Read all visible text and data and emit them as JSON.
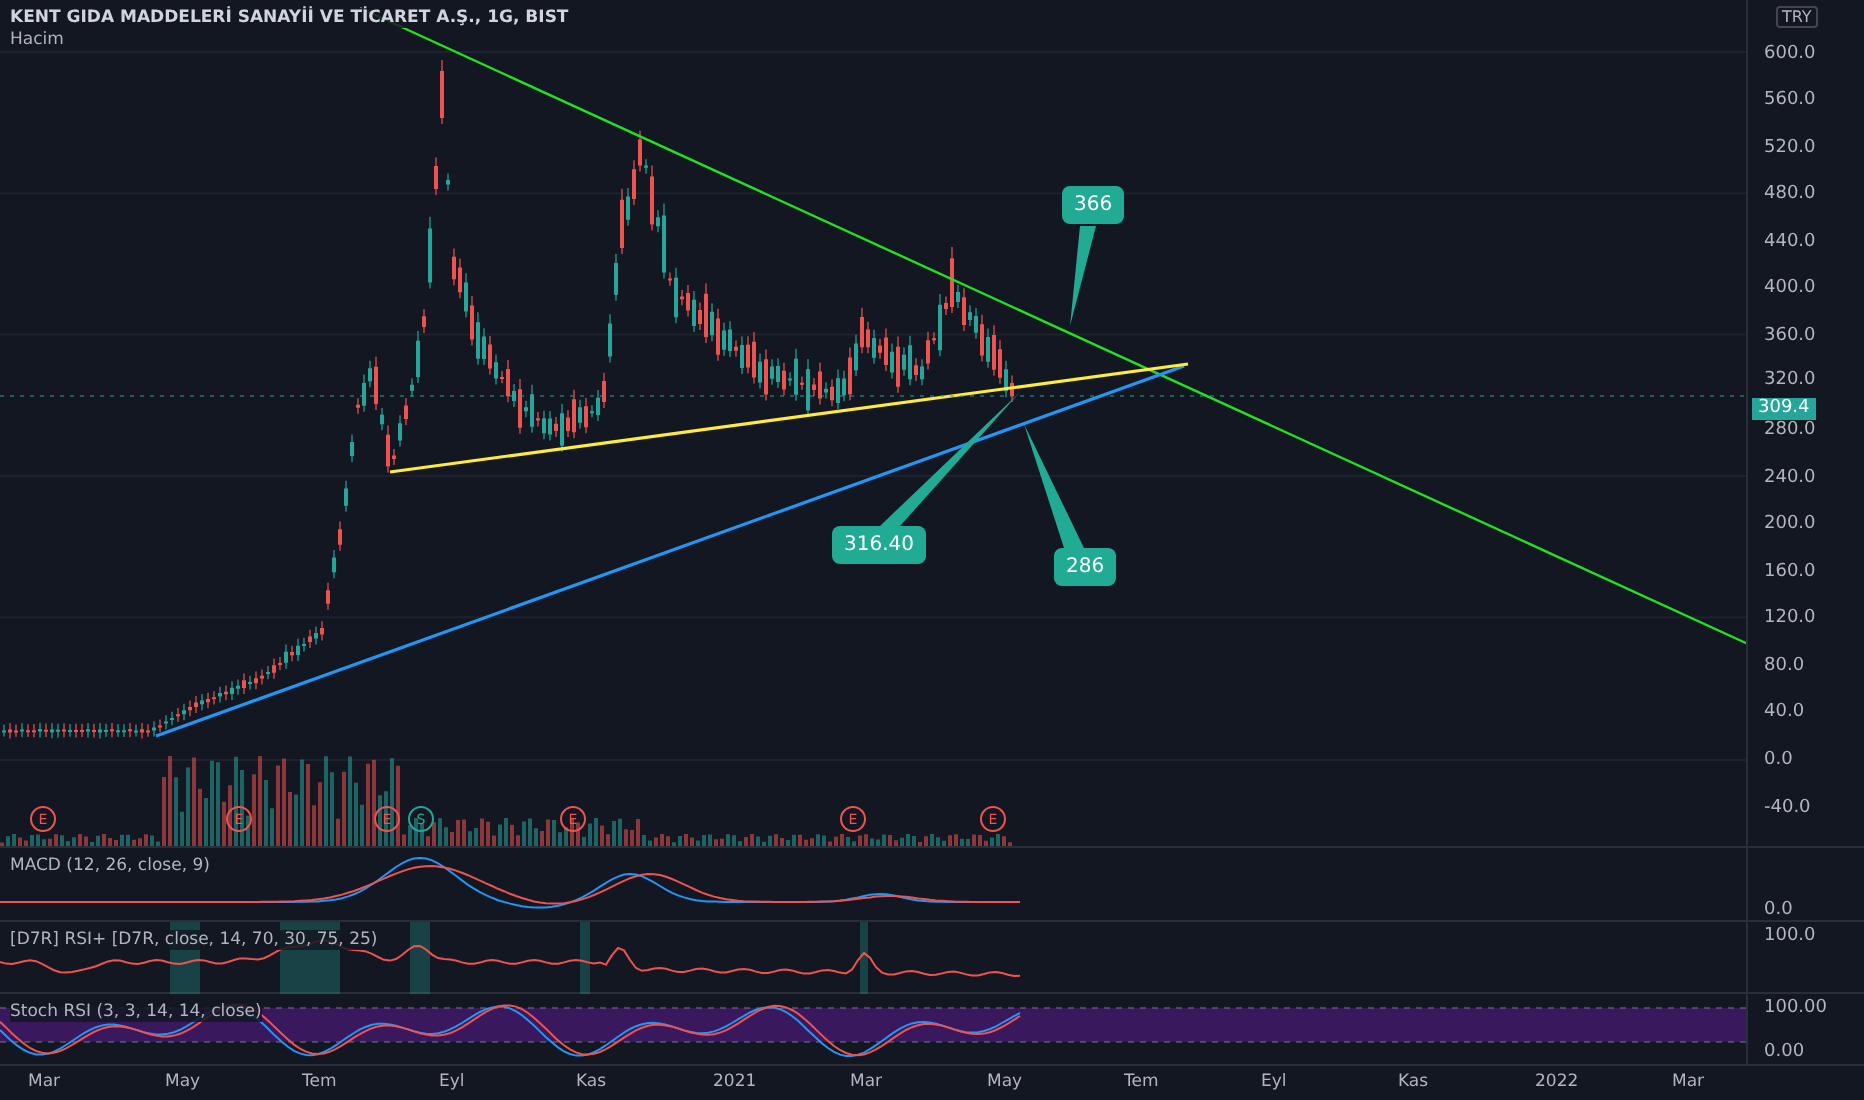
{
  "legend": {
    "title": "KENT GIDA MADDELERİ SANAYİİ VE TİCARET A.Ş., 1G, BIST",
    "volume": "Hacim"
  },
  "currency": "TRY",
  "price_axis": [
    "600.0",
    "560.0",
    "520.0",
    "480.0",
    "440.0",
    "400.0",
    "360.0",
    "320.0",
    "280.0",
    "240.0",
    "200.0",
    "160.0",
    "120.0",
    "80.0",
    "40.0",
    "0.0",
    "-40.0"
  ],
  "last_price": "309.4",
  "callouts": [
    {
      "label": "366"
    },
    {
      "label": "316.40"
    },
    {
      "label": "286"
    }
  ],
  "events": [
    {
      "label": "E",
      "kind": "earnings"
    },
    {
      "label": "E",
      "kind": "earnings"
    },
    {
      "label": "E",
      "kind": "earnings"
    },
    {
      "label": "S",
      "kind": "split"
    },
    {
      "label": "E",
      "kind": "earnings"
    },
    {
      "label": "E",
      "kind": "earnings"
    },
    {
      "label": "E",
      "kind": "earnings"
    }
  ],
  "indicators": [
    {
      "kind": "macd",
      "label": "MACD (12, 26, close, 9)",
      "axis": [
        "0.0"
      ]
    },
    {
      "kind": "rsi",
      "label": "[D7R] RSI+ [D7R, close, 14, 70, 30, 75, 25)",
      "axis": [
        "100.0"
      ]
    },
    {
      "kind": "stoch",
      "label": "Stoch RSI (3, 3, 14, 14, close)",
      "axis": [
        "100.00",
        "0.00"
      ]
    }
  ],
  "time_axis": [
    "Mar",
    "May",
    "Tem",
    "Eyl",
    "Kas",
    "2021",
    "Mar",
    "May",
    "Tem",
    "Eyl",
    "Kas",
    "2022",
    "Mar"
  ]
}
